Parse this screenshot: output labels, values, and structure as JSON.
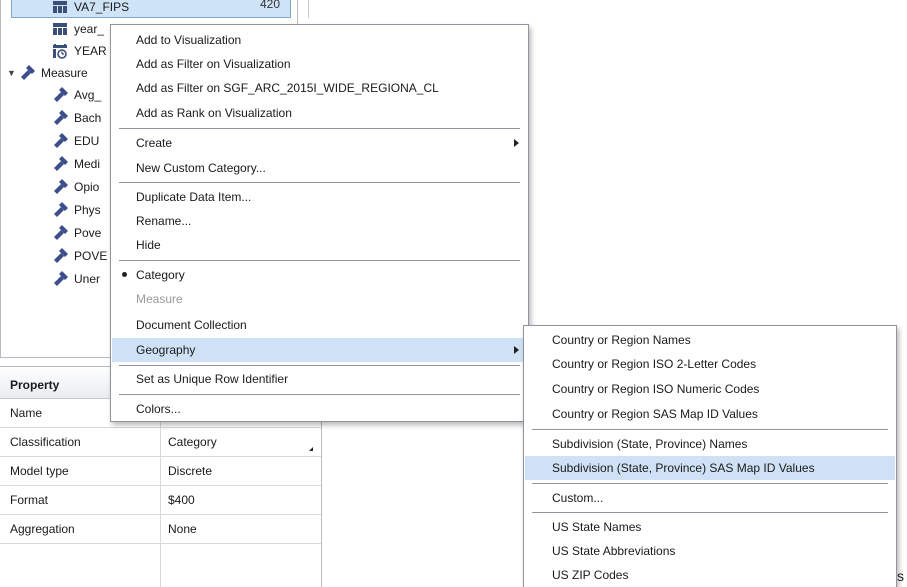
{
  "tree": {
    "selected_item": {
      "label": "VA7_FIPS",
      "count": "420"
    },
    "items": [
      {
        "label": "year_",
        "icon": "category-icon"
      },
      {
        "label": "YEAR",
        "icon": "date-icon"
      }
    ],
    "measures_group": {
      "label": "Measure"
    },
    "measures": [
      {
        "label": "Avg_"
      },
      {
        "label": "Bach"
      },
      {
        "label": "EDU"
      },
      {
        "label": "Medi"
      },
      {
        "label": "Opio"
      },
      {
        "label": "Phys"
      },
      {
        "label": "Pove"
      },
      {
        "label": "POVE"
      },
      {
        "label": "Uner"
      }
    ]
  },
  "properties": {
    "header": "Property",
    "rows": [
      {
        "key": "Name",
        "value": ""
      },
      {
        "key": "Classification",
        "value": "Category"
      },
      {
        "key": "Model type",
        "value": "Discrete"
      },
      {
        "key": "Format",
        "value": "$400"
      },
      {
        "key": "Aggregation",
        "value": "None"
      }
    ]
  },
  "context_menu": {
    "items": [
      {
        "label": "Add to Visualization"
      },
      {
        "label": "Add as Filter on Visualization"
      },
      {
        "label": "Add as Filter on SGF_ARC_2015I_WIDE_REGIONA_CL"
      },
      {
        "label": "Add as Rank on Visualization"
      },
      {
        "label": "Create"
      },
      {
        "label": "New Custom Category..."
      },
      {
        "label": "Duplicate Data Item..."
      },
      {
        "label": "Rename..."
      },
      {
        "label": "Hide"
      },
      {
        "label": "Category"
      },
      {
        "label": "Measure"
      },
      {
        "label": "Document Collection"
      },
      {
        "label": "Geography"
      },
      {
        "label": "Set as Unique Row Identifier"
      },
      {
        "label": "Colors..."
      }
    ]
  },
  "geography_submenu": {
    "items": [
      {
        "label": "Country or Region Names"
      },
      {
        "label": "Country or Region ISO 2-Letter Codes"
      },
      {
        "label": "Country or Region ISO Numeric Codes"
      },
      {
        "label": "Country or Region SAS Map ID Values"
      },
      {
        "label": "Subdivision (State, Province) Names"
      },
      {
        "label": "Subdivision (State, Province) SAS Map ID Values"
      },
      {
        "label": "Custom..."
      },
      {
        "label": "US State Names"
      },
      {
        "label": "US State Abbreviations"
      },
      {
        "label": "US ZIP Codes"
      }
    ]
  },
  "trailing_text": "s",
  "colors": {
    "menu_highlight": "#cfe2f5",
    "selection": "#cfe3f7",
    "category_icon": "#3a4f7a",
    "measure_icon": "#3d4f8a"
  }
}
